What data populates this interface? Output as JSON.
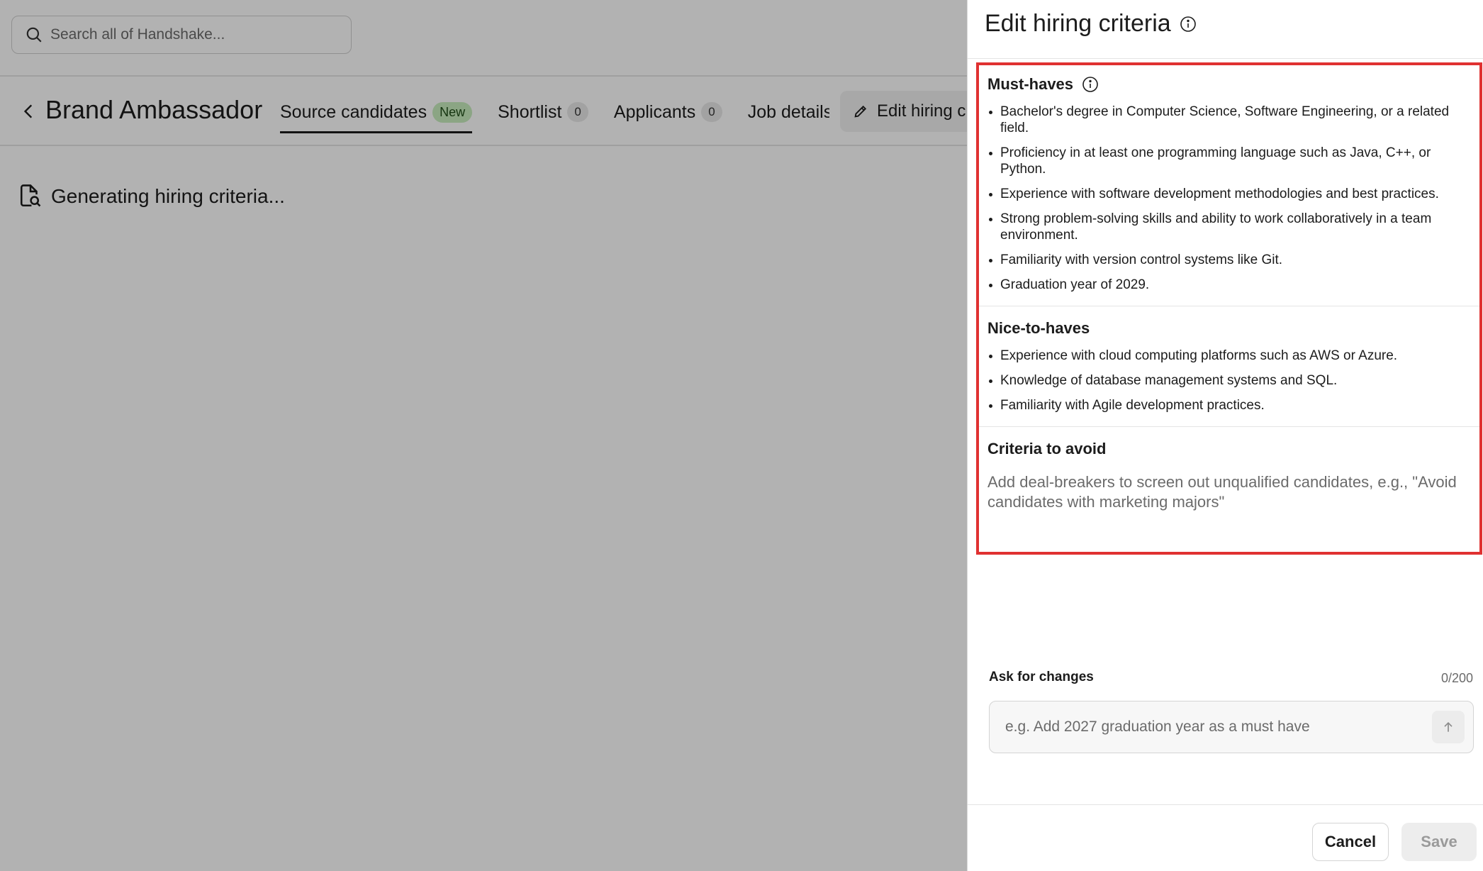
{
  "search": {
    "placeholder": "Search all of Handshake..."
  },
  "job": {
    "title": "Brand Ambassador",
    "tabs": [
      {
        "label": "Source candidates",
        "badge": "New"
      },
      {
        "label": "Shortlist",
        "badge": "0"
      },
      {
        "label": "Applicants",
        "badge": "0"
      },
      {
        "label": "Job details"
      }
    ],
    "edit_button": "Edit hiring criteria"
  },
  "status": {
    "generating": "Generating hiring criteria..."
  },
  "panel": {
    "title": "Edit hiring criteria",
    "must_haves": {
      "heading": "Must-haves",
      "items": [
        "Bachelor's degree in Computer Science, Software Engineering, or a related field.",
        "Proficiency in at least one programming language such as Java, C++, or Python.",
        "Experience with software development methodologies and best practices.",
        "Strong problem-solving skills and ability to work collaboratively in a team environment.",
        "Familiarity with version control systems like Git.",
        "Graduation year of 2029."
      ]
    },
    "nice_to_haves": {
      "heading": "Nice-to-haves",
      "items": [
        "Experience with cloud computing platforms such as AWS or Azure.",
        "Knowledge of database management systems and SQL.",
        "Familiarity with Agile development practices."
      ]
    },
    "avoid": {
      "heading": "Criteria to avoid",
      "placeholder": "Add deal-breakers to screen out unqualified candidates, e.g., \"Avoid candidates with marketing majors\""
    },
    "ask": {
      "label": "Ask for changes",
      "count": "0/200",
      "placeholder": "e.g. Add 2027 graduation year as a must have"
    },
    "footer": {
      "cancel": "Cancel",
      "save": "Save"
    }
  },
  "colors": {
    "highlight_border": "#e03131",
    "badge_new_bg": "#c7ecbd"
  }
}
